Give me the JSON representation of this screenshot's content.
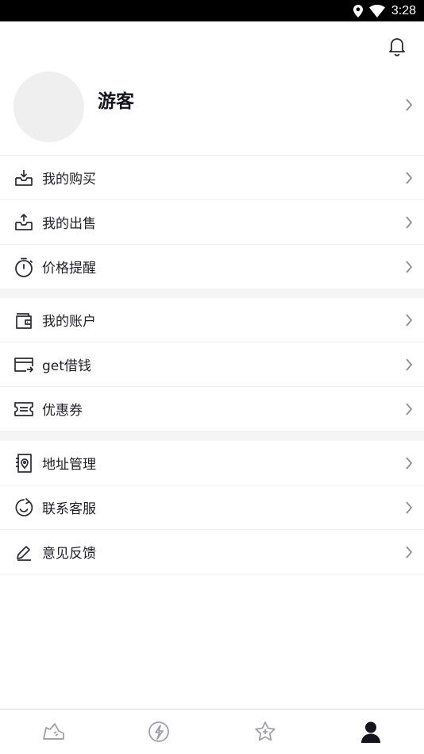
{
  "status_bar": {
    "time": "3:28"
  },
  "profile": {
    "username": "游客"
  },
  "menu_groups": [
    {
      "items": [
        {
          "label": "我的购买",
          "icon": "tray-download-icon"
        },
        {
          "label": "我的出售",
          "icon": "tray-upload-icon"
        },
        {
          "label": "价格提醒",
          "icon": "stopwatch-icon"
        }
      ]
    },
    {
      "items": [
        {
          "label": "我的账户",
          "icon": "wallet-icon"
        },
        {
          "label": "get借钱",
          "icon": "card-transfer-icon"
        },
        {
          "label": "优惠券",
          "icon": "ticket-icon"
        }
      ]
    },
    {
      "items": [
        {
          "label": "地址管理",
          "icon": "location-book-icon"
        },
        {
          "label": "联系客服",
          "icon": "smile-bubble-icon"
        },
        {
          "label": "意见反馈",
          "icon": "pencil-icon"
        }
      ]
    }
  ],
  "tabbar": {
    "tabs": [
      {
        "icon": "sneaker-icon",
        "active": false
      },
      {
        "icon": "flash-icon",
        "active": false
      },
      {
        "icon": "star-plus-icon",
        "active": false
      },
      {
        "icon": "person-icon",
        "active": true
      }
    ]
  },
  "colors": {
    "active_tab": "#15151f",
    "inactive_tab": "#a0a0a8",
    "icon": "#2a2a33",
    "chevron": "#8e8e93"
  }
}
